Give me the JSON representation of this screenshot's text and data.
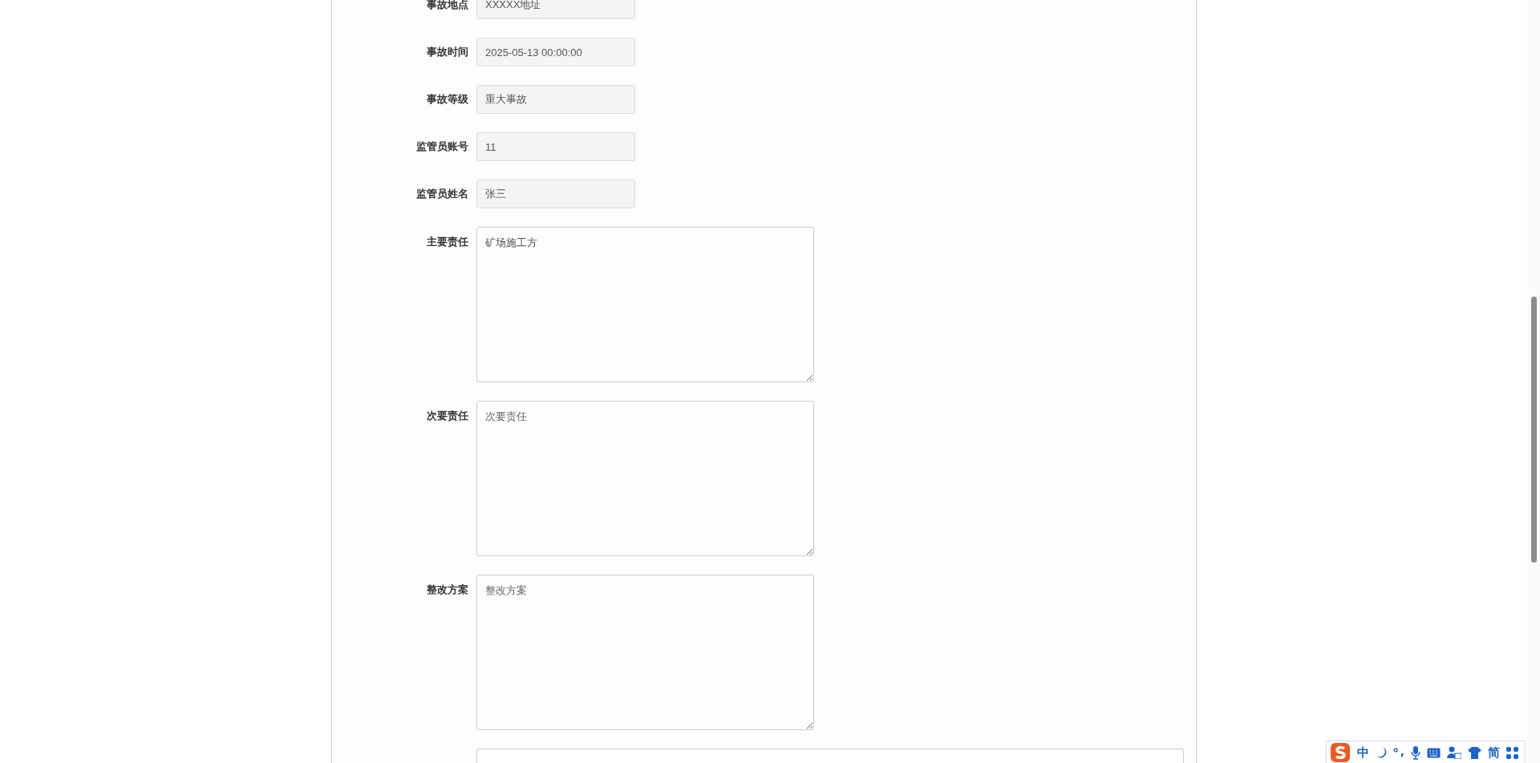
{
  "form": {
    "fields": [
      {
        "kind": "input",
        "label": "事故地点",
        "value": "XXXXX地址"
      },
      {
        "kind": "input",
        "label": "事故时间",
        "value": "2025-05-13 00:00:00"
      },
      {
        "kind": "input",
        "label": "事故等级",
        "value": "重大事故"
      },
      {
        "kind": "input",
        "label": "监管员账号",
        "value": "11"
      },
      {
        "kind": "input",
        "label": "监管员姓名",
        "value": "张三"
      },
      {
        "kind": "textarea",
        "label": "主要责任",
        "value": "矿场施工方"
      },
      {
        "kind": "textarea",
        "label": "次要责任",
        "placeholder": "次要责任"
      },
      {
        "kind": "textarea",
        "label": "整改方案",
        "placeholder": "整改方案"
      }
    ]
  },
  "ime_toolbar": {
    "mode": "中",
    "script": "简"
  }
}
